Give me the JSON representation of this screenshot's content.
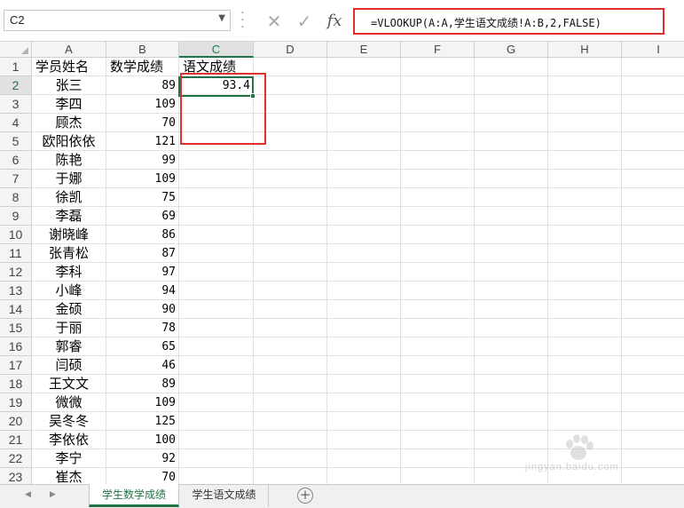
{
  "name_box": {
    "value": "C2"
  },
  "formula_bar": {
    "formula": "=VLOOKUP(A:A,学生语文成绩!A:B,2,FALSE)",
    "fx_label": "fx"
  },
  "columns": [
    "A",
    "B",
    "C",
    "D",
    "E",
    "F",
    "G",
    "H",
    "I"
  ],
  "active_cell": {
    "column": "C",
    "row": 2
  },
  "rows": [
    {
      "num": "1",
      "a": "学员姓名",
      "b": "数学成绩",
      "c": "语文成绩"
    },
    {
      "num": "2",
      "a": "张三",
      "b": "89",
      "c": "93.4"
    },
    {
      "num": "3",
      "a": "李四",
      "b": "109",
      "c": ""
    },
    {
      "num": "4",
      "a": "顾杰",
      "b": "70",
      "c": ""
    },
    {
      "num": "5",
      "a": "欧阳依依",
      "b": "121",
      "c": ""
    },
    {
      "num": "6",
      "a": "陈艳",
      "b": "99",
      "c": ""
    },
    {
      "num": "7",
      "a": "于娜",
      "b": "109",
      "c": ""
    },
    {
      "num": "8",
      "a": "徐凯",
      "b": "75",
      "c": ""
    },
    {
      "num": "9",
      "a": "李磊",
      "b": "69",
      "c": ""
    },
    {
      "num": "10",
      "a": "谢晓峰",
      "b": "86",
      "c": ""
    },
    {
      "num": "11",
      "a": "张青松",
      "b": "87",
      "c": ""
    },
    {
      "num": "12",
      "a": "李科",
      "b": "97",
      "c": ""
    },
    {
      "num": "13",
      "a": "小峰",
      "b": "94",
      "c": ""
    },
    {
      "num": "14",
      "a": "金硕",
      "b": "90",
      "c": ""
    },
    {
      "num": "15",
      "a": "于丽",
      "b": "78",
      "c": ""
    },
    {
      "num": "16",
      "a": "郭睿",
      "b": "65",
      "c": ""
    },
    {
      "num": "17",
      "a": "闫硕",
      "b": "46",
      "c": ""
    },
    {
      "num": "18",
      "a": "王文文",
      "b": "89",
      "c": ""
    },
    {
      "num": "19",
      "a": "微微",
      "b": "109",
      "c": ""
    },
    {
      "num": "20",
      "a": "吴冬冬",
      "b": "125",
      "c": ""
    },
    {
      "num": "21",
      "a": "李依依",
      "b": "100",
      "c": ""
    },
    {
      "num": "22",
      "a": "李宁",
      "b": "92",
      "c": ""
    },
    {
      "num": "23",
      "a": "崔杰",
      "b": "70",
      "c": ""
    }
  ],
  "sheet_tabs": [
    {
      "label": "学生数学成绩",
      "active": true
    },
    {
      "label": "学生语文成绩",
      "active": false
    }
  ],
  "watermark": {
    "text": "jingyan.baidu.com"
  },
  "colors": {
    "accent": "#217346",
    "highlight": "#e0302c"
  }
}
